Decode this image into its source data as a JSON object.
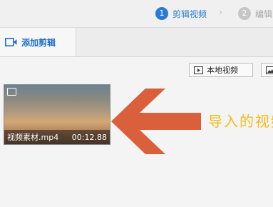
{
  "steps": [
    {
      "number": "1",
      "label": "剪辑视频"
    },
    {
      "number": "2",
      "label": "编辑"
    }
  ],
  "tab": {
    "label": "添加剪辑",
    "icon": "video-camera-icon"
  },
  "toolbar": {
    "local_video_label": "本地视频",
    "local_video_icon": "play-box-icon",
    "image_icon": "image-icon"
  },
  "clip": {
    "filename": "视频素材.mp4",
    "duration": "00:12.88"
  },
  "annotation": {
    "text": "导入的视频",
    "color": "#f3bb1b",
    "arrow_color": "#d9603a"
  }
}
